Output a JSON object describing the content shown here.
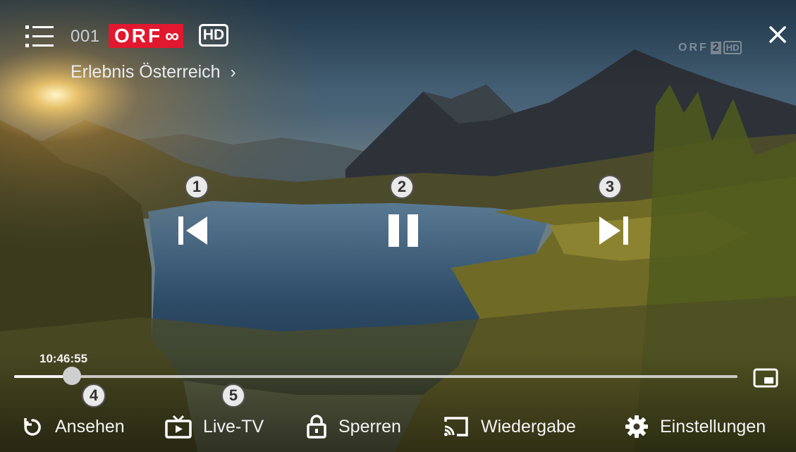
{
  "header": {
    "channel_number": "001",
    "channel_logo_text": "ORF",
    "channel_logo_suffix": "∞",
    "hd_badge": "HD",
    "program_title": "Erlebnis Österreich",
    "program_chevron": "›",
    "watermark": {
      "brand": "ORF",
      "number": "2",
      "hd": "HD"
    }
  },
  "annotations": [
    "1",
    "2",
    "3",
    "4",
    "5"
  ],
  "controls": {
    "previous": {
      "icon": "skip-previous-icon"
    },
    "play_pause": {
      "icon": "pause-icon"
    },
    "next": {
      "icon": "skip-next-icon"
    }
  },
  "playback": {
    "current_time": "10:46:55",
    "progress": 0.08
  },
  "bottom_bar": {
    "items": [
      {
        "label": "Ansehen",
        "icon": "replay-icon"
      },
      {
        "label": "Live-TV",
        "icon": "live-tv-icon"
      },
      {
        "label": "Sperren",
        "icon": "lock-icon"
      },
      {
        "label": "Wiedergabe",
        "icon": "cast-icon"
      },
      {
        "label": "Einstellungen",
        "icon": "gear-icon"
      }
    ]
  },
  "colors": {
    "orf_red": "#e1182e",
    "text": "#f4f4f4"
  }
}
